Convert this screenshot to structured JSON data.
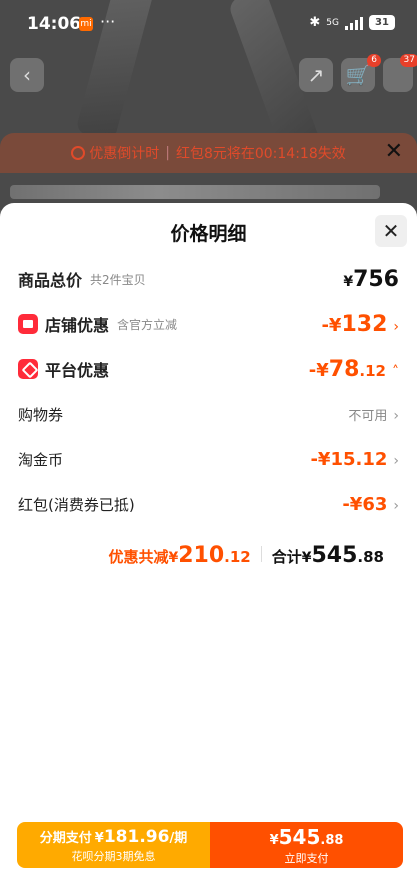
{
  "status_bar": {
    "time": "14:06",
    "mi_badge": "mi",
    "more": "···",
    "network": "5G",
    "battery": "31"
  },
  "background": {
    "cart_badge": "6",
    "more_badge": "37",
    "countdown": {
      "label": "优惠倒计时",
      "message": "红包8元将在00:14:18失效"
    }
  },
  "sheet": {
    "title": "价格明细",
    "rows": {
      "total": {
        "label": "商品总价",
        "sub": "共2件宝贝",
        "yen": "¥",
        "value": "756"
      },
      "store_discount": {
        "label": "店铺优惠",
        "sub": "含官方立减",
        "prefix": "-¥",
        "value": "132"
      },
      "platform_discount": {
        "label": "平台优惠",
        "prefix": "-¥",
        "value": "78",
        "decimal": ".12"
      },
      "shopping_voucher": {
        "label": "购物券",
        "status": "不可用"
      },
      "taojinbi": {
        "label": "淘金币",
        "prefix": "-¥",
        "value": "15.12"
      },
      "red_packet": {
        "label": "红包(消费券已抵)",
        "prefix": "-¥",
        "value": "63"
      }
    },
    "summary": {
      "discount_label": "优惠共减",
      "discount_yen": "¥",
      "discount_value": "210",
      "discount_decimal": ".12",
      "total_label": "合计",
      "total_yen": "¥",
      "total_value": "545",
      "total_decimal": ".88"
    }
  },
  "bottom_bar": {
    "installment": {
      "prefix": "分期支付",
      "yen": "¥",
      "amount": "181.96",
      "unit": "/期",
      "note": "花呗分期3期免息"
    },
    "pay_now": {
      "yen": "¥",
      "amount": "545",
      "decimal": ".88",
      "label": "立即支付"
    }
  },
  "colors": {
    "accent": "#ff5000",
    "installment_bg": "#ffaa00",
    "shop_icon": "#ff2b3a"
  }
}
